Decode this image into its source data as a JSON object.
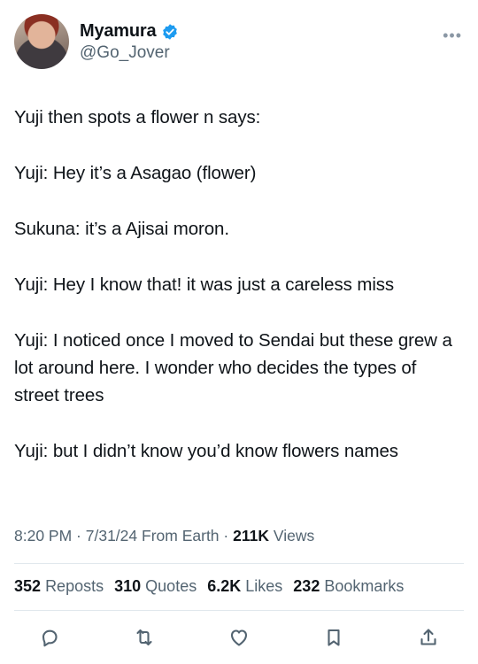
{
  "author": {
    "display_name": "Myamura",
    "handle": "@Go_Jover"
  },
  "more_label": "•••",
  "tweet": {
    "paragraphs": [
      "Yuji then spots a flower n says:",
      "Yuji: Hey it’s a Asagao (flower)",
      "Sukuna: it’s a Ajisai moron.",
      "Yuji: Hey I know that! it was just a careless miss",
      "Yuji: I noticed once I moved to Sendai but these grew a lot around here. I wonder who decides the types of street trees",
      "Yuji: but I didn’t know you’d know flowers names"
    ]
  },
  "meta": {
    "time": "8:20 PM",
    "date": "7/31/24",
    "source": "From Earth",
    "views_count": "211K",
    "views_label": "Views"
  },
  "stats": {
    "reposts_count": "352",
    "reposts_label": "Reposts",
    "quotes_count": "310",
    "quotes_label": "Quotes",
    "likes_count": "6.2K",
    "likes_label": "Likes",
    "bookmarks_count": "232",
    "bookmarks_label": "Bookmarks"
  },
  "icons": {
    "verified": "verified-badge-icon",
    "reply": "reply-icon",
    "repost": "repost-icon",
    "like": "heart-icon",
    "bookmark": "bookmark-icon",
    "share": "share-icon"
  },
  "colors": {
    "verified": "#1d9bf0",
    "text": "#0f1419",
    "secondary": "#536471",
    "action_icon": "#536471"
  }
}
